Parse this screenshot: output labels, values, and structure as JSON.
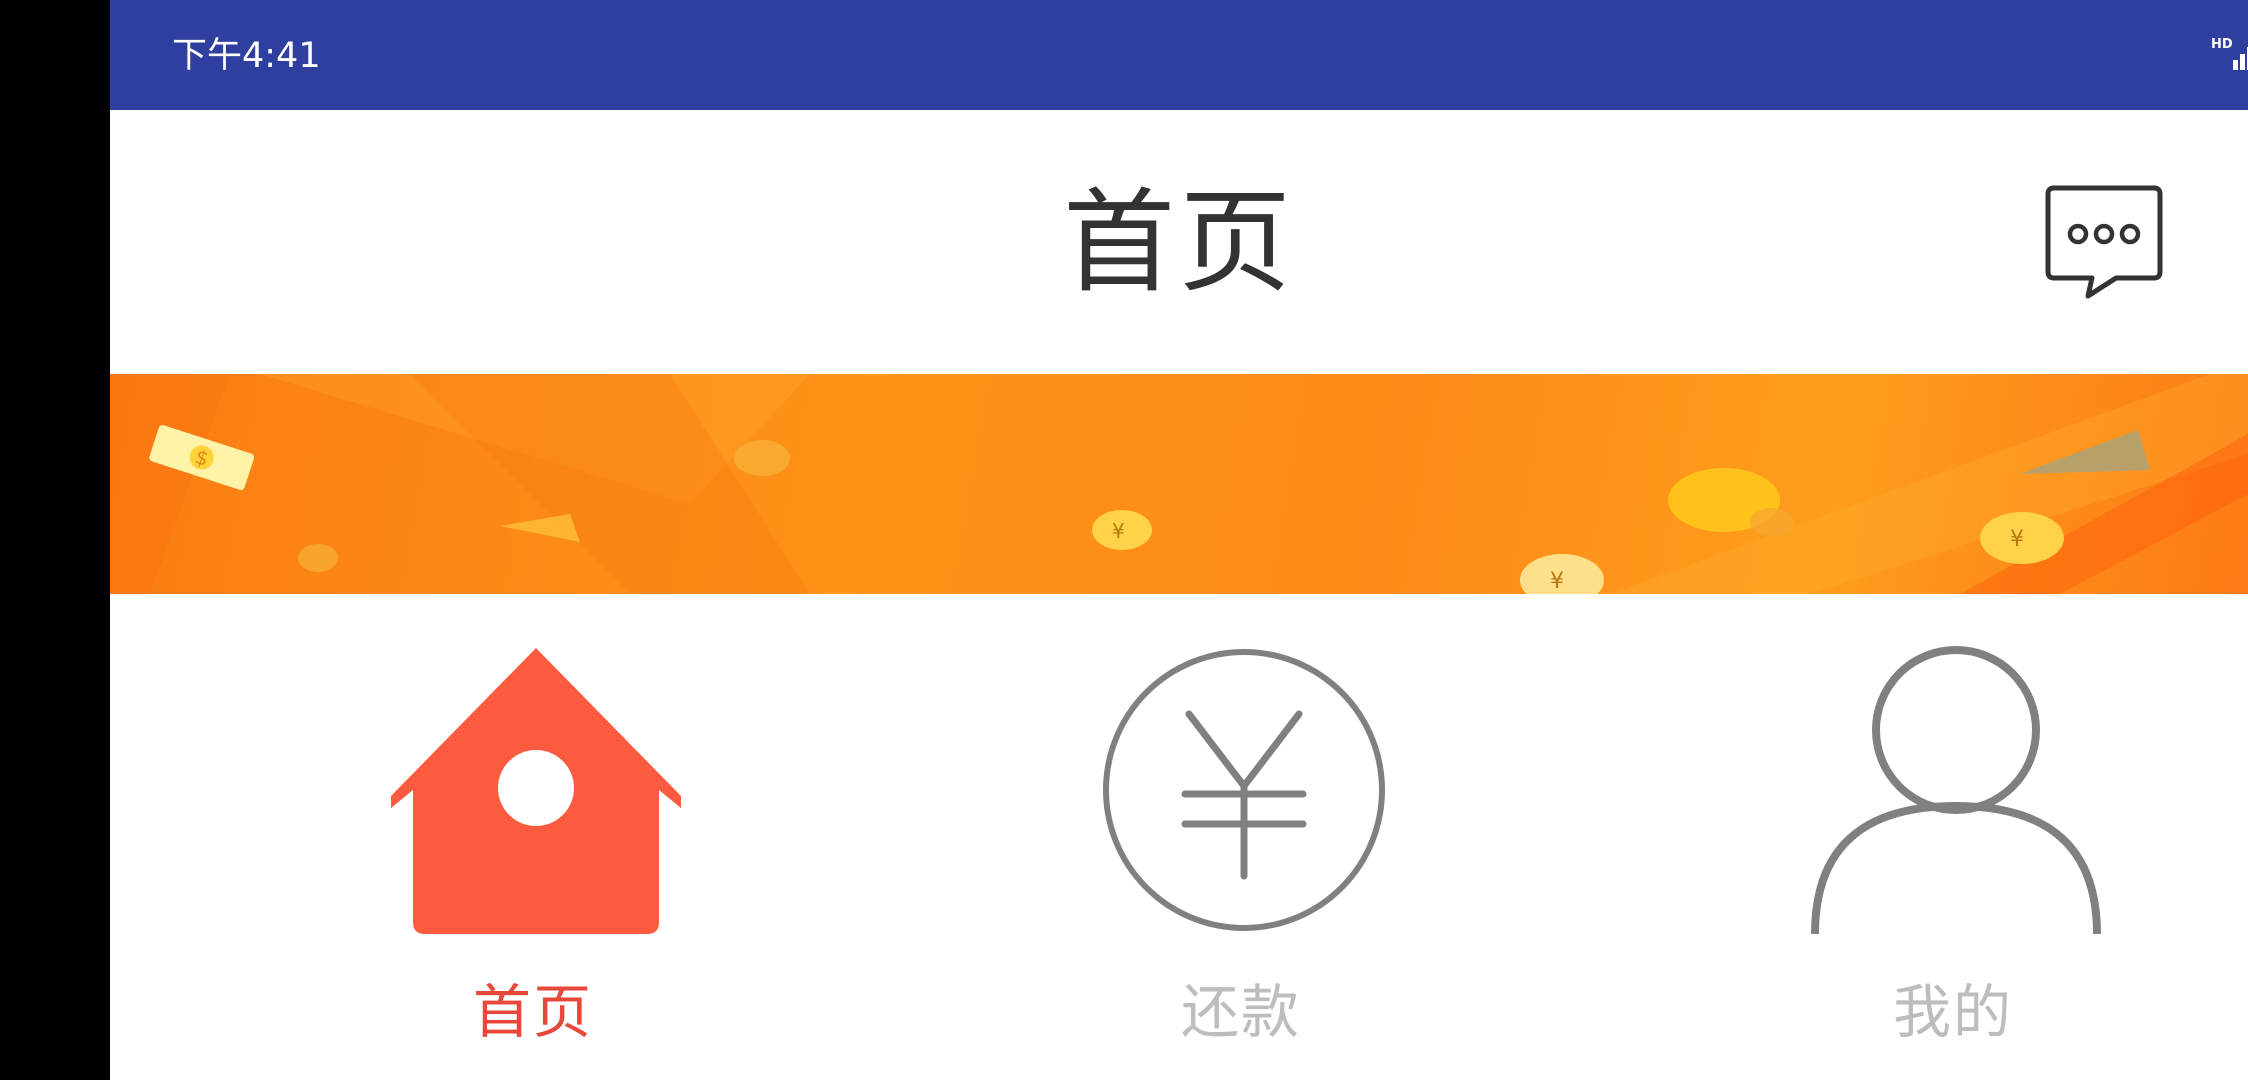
{
  "status_bar": {
    "time": "下午4:41",
    "icons": [
      "hd-signal-icon",
      "wifi-icon",
      "battery-charging-icon"
    ]
  },
  "header": {
    "title": "首页",
    "message_icon": "chat-bubble-icon"
  },
  "banner": {
    "background_colors": [
      "#fb7d13",
      "#fd9317",
      "#fe9d1d"
    ],
    "decorations": [
      "dollar-bill-icon",
      "coin-icon",
      "paper-plane-icon"
    ]
  },
  "bottom_nav": {
    "items": [
      {
        "label": "首页",
        "icon": "home-icon",
        "active": true,
        "color": "#e8483a"
      },
      {
        "label": "还款",
        "icon": "yen-circle-icon",
        "active": false,
        "color": "#bdbdbd"
      },
      {
        "label": "我的",
        "icon": "person-icon",
        "active": false,
        "color": "#bdbdbd"
      }
    ]
  },
  "colors": {
    "status_bar": "#2f3f9f",
    "accent": "#fd5b40",
    "active_label": "#e8483a",
    "inactive_icon": "#808080",
    "inactive_label": "#bdbdbd"
  }
}
